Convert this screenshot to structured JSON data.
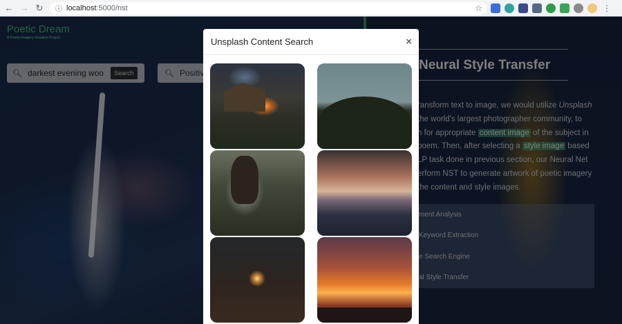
{
  "browser": {
    "url_host": "localhost",
    "url_path": ":5000/nst"
  },
  "brand": {
    "title": "Poetic Dream",
    "subtitle": "A Poetry Imagery Visualize Project"
  },
  "search": {
    "content_query": "darkest evening woo",
    "search_button": "Search",
    "style_query": "Positiv"
  },
  "nst": {
    "title": "Neural Style Transfer",
    "paragraph": {
      "p1": "ransform text to image, we would utilize ",
      "unsplash": "Unsplash",
      "p2": " the world's largest photographer community, to",
      "p3": "h for appropriate ",
      "content_image": "content image",
      "p4": " of the subject in",
      "p5": "poem. Then, after selecting a ",
      "style_image": "style image",
      "p6": " based",
      "p7": "LP task done in previous section, our Neural Net",
      "p8": "erform NST to generate artwork of poetic imagery",
      "p9": "the content and style images."
    },
    "list": [
      "ment Analysis",
      "Keyword Extraction",
      "e Search Engine",
      "al Style Transfer"
    ]
  },
  "modal": {
    "title": "Unsplash Content Search",
    "close_glyph": "×",
    "images": [
      "cabin-campfire-photo",
      "forest-hill-photo",
      "woman-forest-photo",
      "cloud-sunset-photo",
      "sparkler-photo",
      "orange-sunset-photo"
    ]
  }
}
